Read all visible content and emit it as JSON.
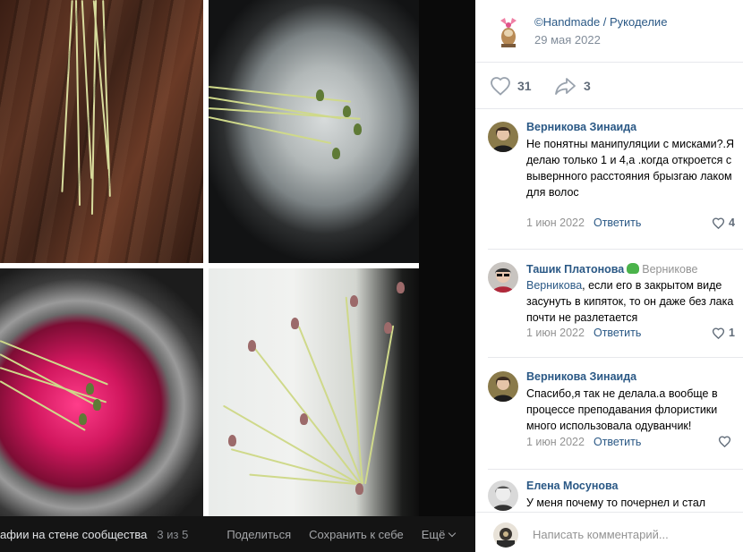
{
  "photo_bar": {
    "album": "афии на стене сообщества",
    "counter": "3 из 5",
    "share": "Поделиться",
    "save": "Сохранить к себе",
    "more": "Ещё"
  },
  "post": {
    "group_name": "©Handmade / Рукоделие",
    "date": "29 мая 2022",
    "likes": "31",
    "shares": "3"
  },
  "comments": [
    {
      "author": "Верникова Зинаида",
      "text": "Не понятны манипуляции с мисками?.Я делаю только 1 и 4,а .когда откроется с вывернного расстояния брызгаю лаком для волос",
      "date": "1 июн 2022",
      "reply": "Ответить",
      "likes": "4"
    },
    {
      "author": "Ташик Платонова",
      "reply_to": "Верникове",
      "mention": "Верникова",
      "text": ", если его в закрытом виде засунуть в кипяток, то он даже без лака почти не разлетается",
      "date": "1 июн 2022",
      "reply": "Ответить",
      "likes": "1"
    },
    {
      "author": "Верникова Зинаида",
      "text": "Спасибо,я так не делала.а вообще в процессе преподавания флористики много использовала одуванчик!",
      "date": "1 июн 2022",
      "reply": "Ответить",
      "likes": ""
    },
    {
      "author": "Елена Мосунова",
      "text": "У меня почему то почернел и стал",
      "date": "",
      "reply": "",
      "likes": ""
    }
  ],
  "compose": {
    "placeholder": "Написать комментарий..."
  },
  "colors": {
    "link": "#2a5885",
    "muted": "#939393",
    "dark_bar": "#141414"
  }
}
